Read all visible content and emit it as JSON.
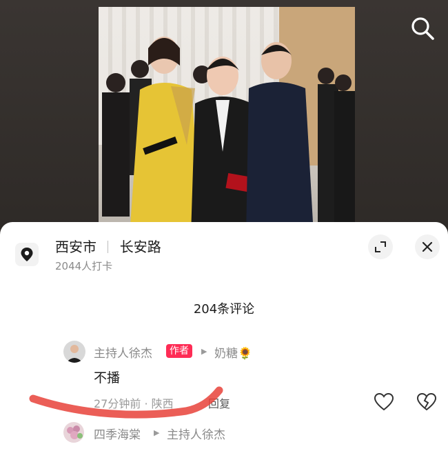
{
  "location": {
    "city": "西安市",
    "road": "长安路",
    "checkins": "2044人打卡"
  },
  "comments": {
    "count_label": "204条评论",
    "items": [
      {
        "author": "主持人徐杰",
        "badge": "作者",
        "reply_to": "奶糖",
        "reply_to_emoji": "🌻",
        "text": "不播",
        "time": "27分钟前 · 陕西",
        "reply_label": "回复"
      },
      {
        "author": "四季海棠",
        "reply_to": "主持人徐杰"
      }
    ]
  },
  "colors": {
    "accent": "#fe2c55",
    "scribble": "#e8423a"
  },
  "icons": [
    "search-icon",
    "location-pin-icon",
    "expand-icon",
    "close-icon",
    "like-heart-icon",
    "dislike-heart-icon"
  ]
}
